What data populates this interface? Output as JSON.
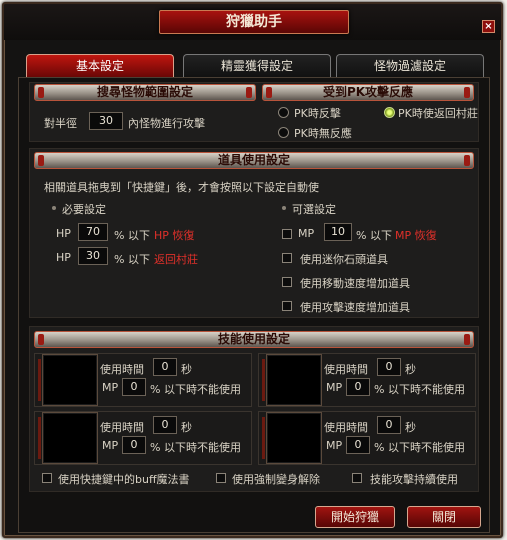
{
  "window": {
    "title": "狩獵助手",
    "close_symbol": "×"
  },
  "tabs": [
    {
      "label": "基本設定",
      "active": true
    },
    {
      "label": "精靈獲得設定",
      "active": false
    },
    {
      "label": "怪物過濾設定",
      "active": false
    }
  ],
  "search_range": {
    "header": "搜尋怪物範圍設定",
    "prefix": "對半徑",
    "radius": "30",
    "suffix": "內怪物進行攻擊"
  },
  "pk_reaction": {
    "header": "受到PK攻擊反應",
    "options": [
      {
        "label": "PK時反擊",
        "selected": false
      },
      {
        "label": "PK時使返回村莊",
        "selected": true
      },
      {
        "label": "PK時無反應",
        "selected": false
      }
    ]
  },
  "item_usage": {
    "header": "道具使用設定",
    "description": "相關道具拖曳到「快捷鍵」後，才會按照以下設定自動使",
    "required": {
      "title": "必要設定",
      "rows": [
        {
          "stat": "HP",
          "value": "70",
          "unit": "% 以下",
          "action": "HP 恢復"
        },
        {
          "stat": "HP",
          "value": "30",
          "unit": "% 以下",
          "action": "返回村莊"
        }
      ]
    },
    "optional": {
      "title": "可選設定",
      "mp_row": {
        "stat": "MP",
        "value": "10",
        "unit": "% 以下",
        "action": "MP 恢復"
      },
      "checks": [
        {
          "label": "使用迷你石頭道具",
          "checked": false
        },
        {
          "label": "使用移動速度增加道具",
          "checked": false
        },
        {
          "label": "使用攻擊速度增加道具",
          "checked": false
        }
      ]
    }
  },
  "skill_usage": {
    "header": "技能使用設定",
    "slots": [
      {
        "time_label": "使用時間",
        "time_value": "0",
        "time_unit": "秒",
        "mp_label": "MP",
        "mp_value": "0",
        "mp_suffix": "% 以下時不能使用"
      },
      {
        "time_label": "使用時間",
        "time_value": "0",
        "time_unit": "秒",
        "mp_label": "MP",
        "mp_value": "0",
        "mp_suffix": "% 以下時不能使用"
      },
      {
        "time_label": "使用時間",
        "time_value": "0",
        "time_unit": "秒",
        "mp_label": "MP",
        "mp_value": "0",
        "mp_suffix": "% 以下時不能使用"
      },
      {
        "time_label": "使用時間",
        "time_value": "0",
        "time_unit": "秒",
        "mp_label": "MP",
        "mp_value": "0",
        "mp_suffix": "% 以下時不能使用"
      }
    ],
    "options": [
      {
        "label": "使用快捷鍵中的buff魔法書",
        "checked": false
      },
      {
        "label": "使用強制變身解除",
        "checked": false
      },
      {
        "label": "技能攻擊持續使用",
        "checked": false
      }
    ]
  },
  "buttons": {
    "start": "開始狩獵",
    "close": "關閉"
  },
  "colors": {
    "accent_red": "#a11410",
    "warning_text": "#e0302a",
    "header_border": "#b8543b"
  }
}
